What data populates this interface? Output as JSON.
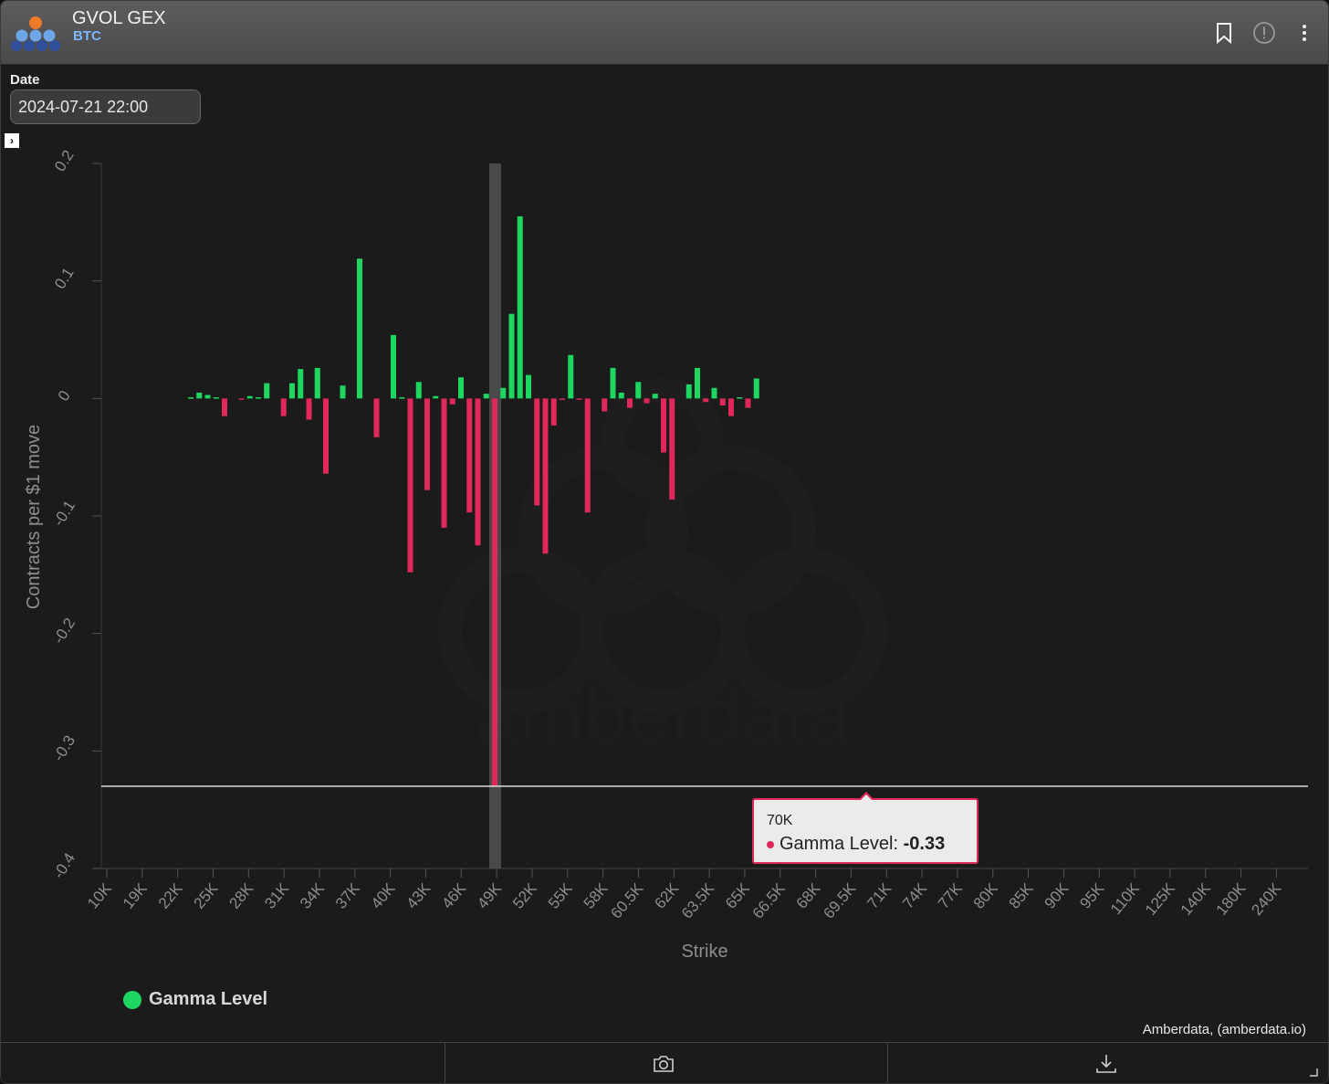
{
  "header": {
    "title": "GVOL GEX",
    "subtitle": "BTC"
  },
  "date": {
    "label": "Date",
    "value": "2024-07-21 22:00"
  },
  "chart_data": {
    "type": "bar",
    "ylabel": "Contracts per $1 move",
    "xlabel": "Strike",
    "ylim": [
      -0.4,
      0.2
    ],
    "yticks": [
      "0.2",
      "0.1",
      "0",
      "-0.1",
      "-0.2",
      "-0.3",
      "-0.4"
    ],
    "xticks": [
      "10K",
      "19K",
      "22K",
      "25K",
      "28K",
      "31K",
      "34K",
      "37K",
      "40K",
      "43K",
      "46K",
      "49K",
      "52K",
      "55K",
      "58K",
      "60.5K",
      "62K",
      "63.5K",
      "65K",
      "66.5K",
      "68K",
      "69.5K",
      "71K",
      "74K",
      "77K",
      "80K",
      "85K",
      "90K",
      "95K",
      "110K",
      "125K",
      "140K",
      "180K",
      "240K"
    ],
    "series": [
      {
        "name": "Gamma Level",
        "color": "#1ed760",
        "negative_color": "#e0285a"
      }
    ],
    "bars": [
      {
        "x": 10,
        "v": 0.001
      },
      {
        "x": 11,
        "v": 0.005
      },
      {
        "x": 12,
        "v": 0.003
      },
      {
        "x": 13,
        "v": 0.001
      },
      {
        "x": 14,
        "v": -0.015
      },
      {
        "x": 15,
        "v": 0.0
      },
      {
        "x": 16,
        "v": -0.001
      },
      {
        "x": 17,
        "v": 0.002
      },
      {
        "x": 18,
        "v": 0.001
      },
      {
        "x": 19,
        "v": 0.013
      },
      {
        "x": 20,
        "v": 0.0
      },
      {
        "x": 21,
        "v": -0.015
      },
      {
        "x": 22,
        "v": 0.013
      },
      {
        "x": 23,
        "v": 0.025
      },
      {
        "x": 24,
        "v": -0.018
      },
      {
        "x": 25,
        "v": 0.026
      },
      {
        "x": 26,
        "v": -0.064
      },
      {
        "x": 27,
        "v": 0.0
      },
      {
        "x": 28,
        "v": 0.011
      },
      {
        "x": 29,
        "v": 0.0
      },
      {
        "x": 30,
        "v": 0.119
      },
      {
        "x": 31,
        "v": 0.0
      },
      {
        "x": 32,
        "v": -0.033
      },
      {
        "x": 33,
        "v": 0.0
      },
      {
        "x": 34,
        "v": 0.054
      },
      {
        "x": 35,
        "v": 0.001
      },
      {
        "x": 36,
        "v": -0.148
      },
      {
        "x": 37,
        "v": 0.014
      },
      {
        "x": 38,
        "v": -0.078
      },
      {
        "x": 39,
        "v": 0.002
      },
      {
        "x": 40,
        "v": -0.11
      },
      {
        "x": 41,
        "v": -0.005
      },
      {
        "x": 42,
        "v": 0.018
      },
      {
        "x": 43,
        "v": -0.097
      },
      {
        "x": 44,
        "v": -0.125
      },
      {
        "x": 45,
        "v": 0.004
      },
      {
        "x": 46,
        "v": -0.33
      },
      {
        "x": 47,
        "v": 0.009
      },
      {
        "x": 48,
        "v": 0.072
      },
      {
        "x": 49,
        "v": 0.155
      },
      {
        "x": 50,
        "v": 0.02
      },
      {
        "x": 51,
        "v": -0.091
      },
      {
        "x": 52,
        "v": -0.132
      },
      {
        "x": 53,
        "v": -0.023
      },
      {
        "x": 54,
        "v": -0.001
      },
      {
        "x": 55,
        "v": 0.037
      },
      {
        "x": 56,
        "v": -0.001
      },
      {
        "x": 57,
        "v": -0.097
      },
      {
        "x": 58,
        "v": 0.0
      },
      {
        "x": 59,
        "v": -0.011
      },
      {
        "x": 60,
        "v": 0.026
      },
      {
        "x": 61,
        "v": 0.005
      },
      {
        "x": 62,
        "v": -0.008
      },
      {
        "x": 63,
        "v": 0.014
      },
      {
        "x": 64,
        "v": -0.004
      },
      {
        "x": 65,
        "v": 0.004
      },
      {
        "x": 66,
        "v": -0.046
      },
      {
        "x": 67,
        "v": -0.086
      },
      {
        "x": 68,
        "v": 0.0
      },
      {
        "x": 69,
        "v": 0.012
      },
      {
        "x": 70,
        "v": 0.026
      },
      {
        "x": 71,
        "v": -0.003
      },
      {
        "x": 72,
        "v": 0.009
      },
      {
        "x": 73,
        "v": -0.006
      },
      {
        "x": 74,
        "v": -0.015
      },
      {
        "x": 75,
        "v": 0.001
      },
      {
        "x": 76,
        "v": -0.008
      },
      {
        "x": 77,
        "v": 0.017
      }
    ],
    "highlight": {
      "x": 46,
      "v": -0.33
    },
    "tooltip": {
      "category": "70K",
      "series": "Gamma Level:",
      "value": "-0.33"
    },
    "watermark": "amberdata"
  },
  "legend": {
    "label": "Gamma Level"
  },
  "credit": "Amberdata, (amberdata.io)",
  "icons": {
    "bookmark": "bookmark-icon",
    "info": "info-icon",
    "menu": "more-vert-icon",
    "camera": "camera-icon",
    "download": "download-icon"
  }
}
